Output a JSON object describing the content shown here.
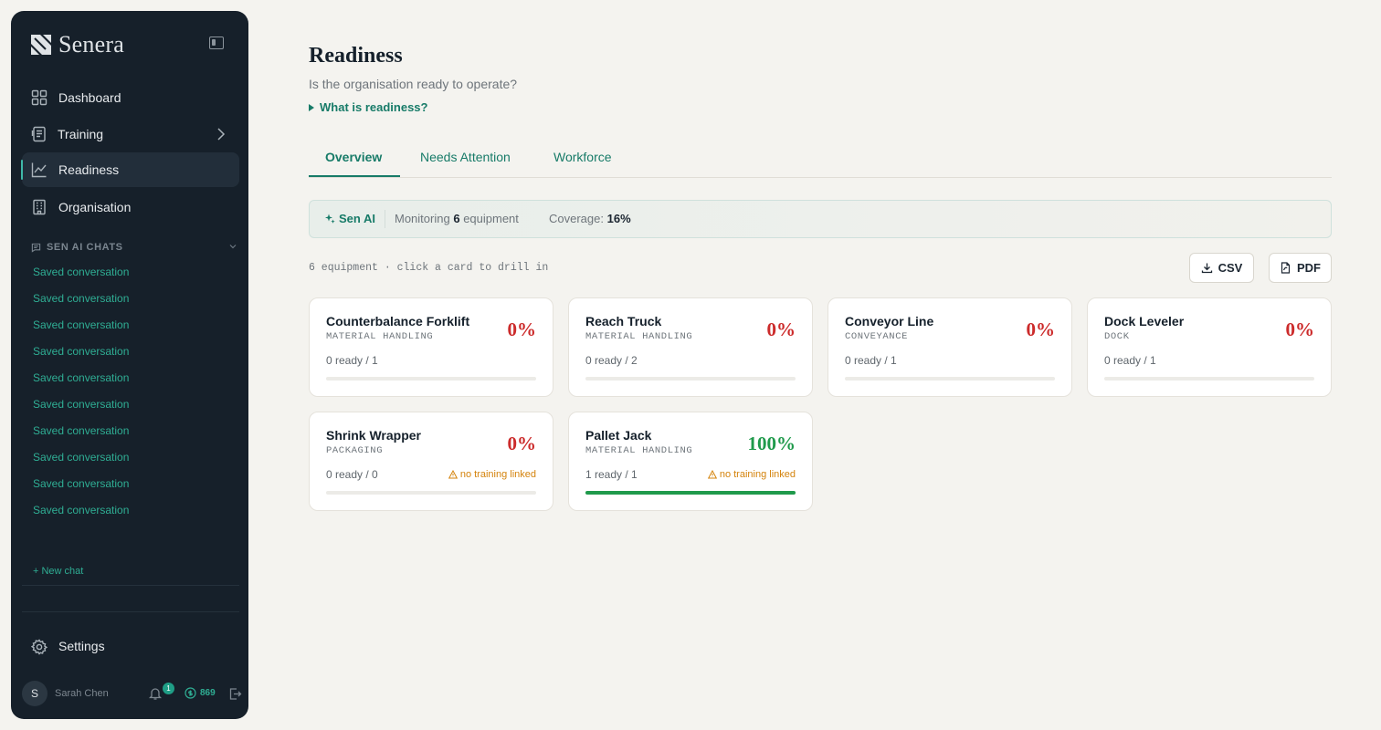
{
  "brand": {
    "name": "Senera"
  },
  "sidebar": {
    "nav": [
      {
        "label": "Dashboard",
        "icon": "grid-icon"
      },
      {
        "label": "Training",
        "icon": "document-list-icon"
      },
      {
        "label": "Readiness",
        "icon": "trend-chart-icon",
        "active": true
      },
      {
        "label": "Organisation",
        "icon": "building-icon"
      }
    ],
    "chats_header": "SEN AI CHATS",
    "chats": [
      "Saved conversation",
      "Saved conversation",
      "Saved conversation",
      "Saved conversation",
      "Saved conversation",
      "Saved conversation",
      "Saved conversation",
      "Saved conversation",
      "Saved conversation",
      "Saved conversation"
    ],
    "new_chat": "+ New chat",
    "settings": "Settings",
    "user": {
      "initial": "S",
      "name": "Sarah Chen",
      "notifications": "1",
      "credits": "869"
    }
  },
  "page": {
    "title": "Readiness",
    "subtitle": "Is the organisation ready to operate?",
    "what_link": "What is readiness?",
    "tabs": [
      "Overview",
      "Needs Attention",
      "Workforce"
    ]
  },
  "ai_bar": {
    "label": "Sen AI",
    "monitoring_prefix": "Monitoring",
    "monitoring_count": "6",
    "monitoring_suffix": "equipment",
    "coverage_label": "Coverage:",
    "coverage_value": "16%"
  },
  "summary": "6 equipment · click a card to drill in",
  "export": {
    "csv": "CSV",
    "pdf": "PDF"
  },
  "cards": [
    {
      "name": "Counterbalance Forklift",
      "category": "MATERIAL HANDLING",
      "pct": "0%",
      "ready": "0 ready / 1",
      "warning": "",
      "progress": 0
    },
    {
      "name": "Reach Truck",
      "category": "MATERIAL HANDLING",
      "pct": "0%",
      "ready": "0 ready / 2",
      "warning": "",
      "progress": 0
    },
    {
      "name": "Conveyor Line",
      "category": "CONVEYANCE",
      "pct": "0%",
      "ready": "0 ready / 1",
      "warning": "",
      "progress": 0
    },
    {
      "name": "Dock Leveler",
      "category": "DOCK",
      "pct": "0%",
      "ready": "0 ready / 1",
      "warning": "",
      "progress": 0
    },
    {
      "name": "Shrink Wrapper",
      "category": "PACKAGING",
      "pct": "0%",
      "ready": "0 ready / 0",
      "warning": "no training linked",
      "progress": 0
    },
    {
      "name": "Pallet Jack",
      "category": "MATERIAL HANDLING",
      "pct": "100%",
      "ready": "1 ready / 1",
      "warning": "no training linked",
      "progress": 100
    }
  ],
  "colors": {
    "accent": "#177b68",
    "danger": "#cc2b2b",
    "success": "#1f9a4b",
    "warning": "#d4830c",
    "sidebar": "#16202a"
  }
}
